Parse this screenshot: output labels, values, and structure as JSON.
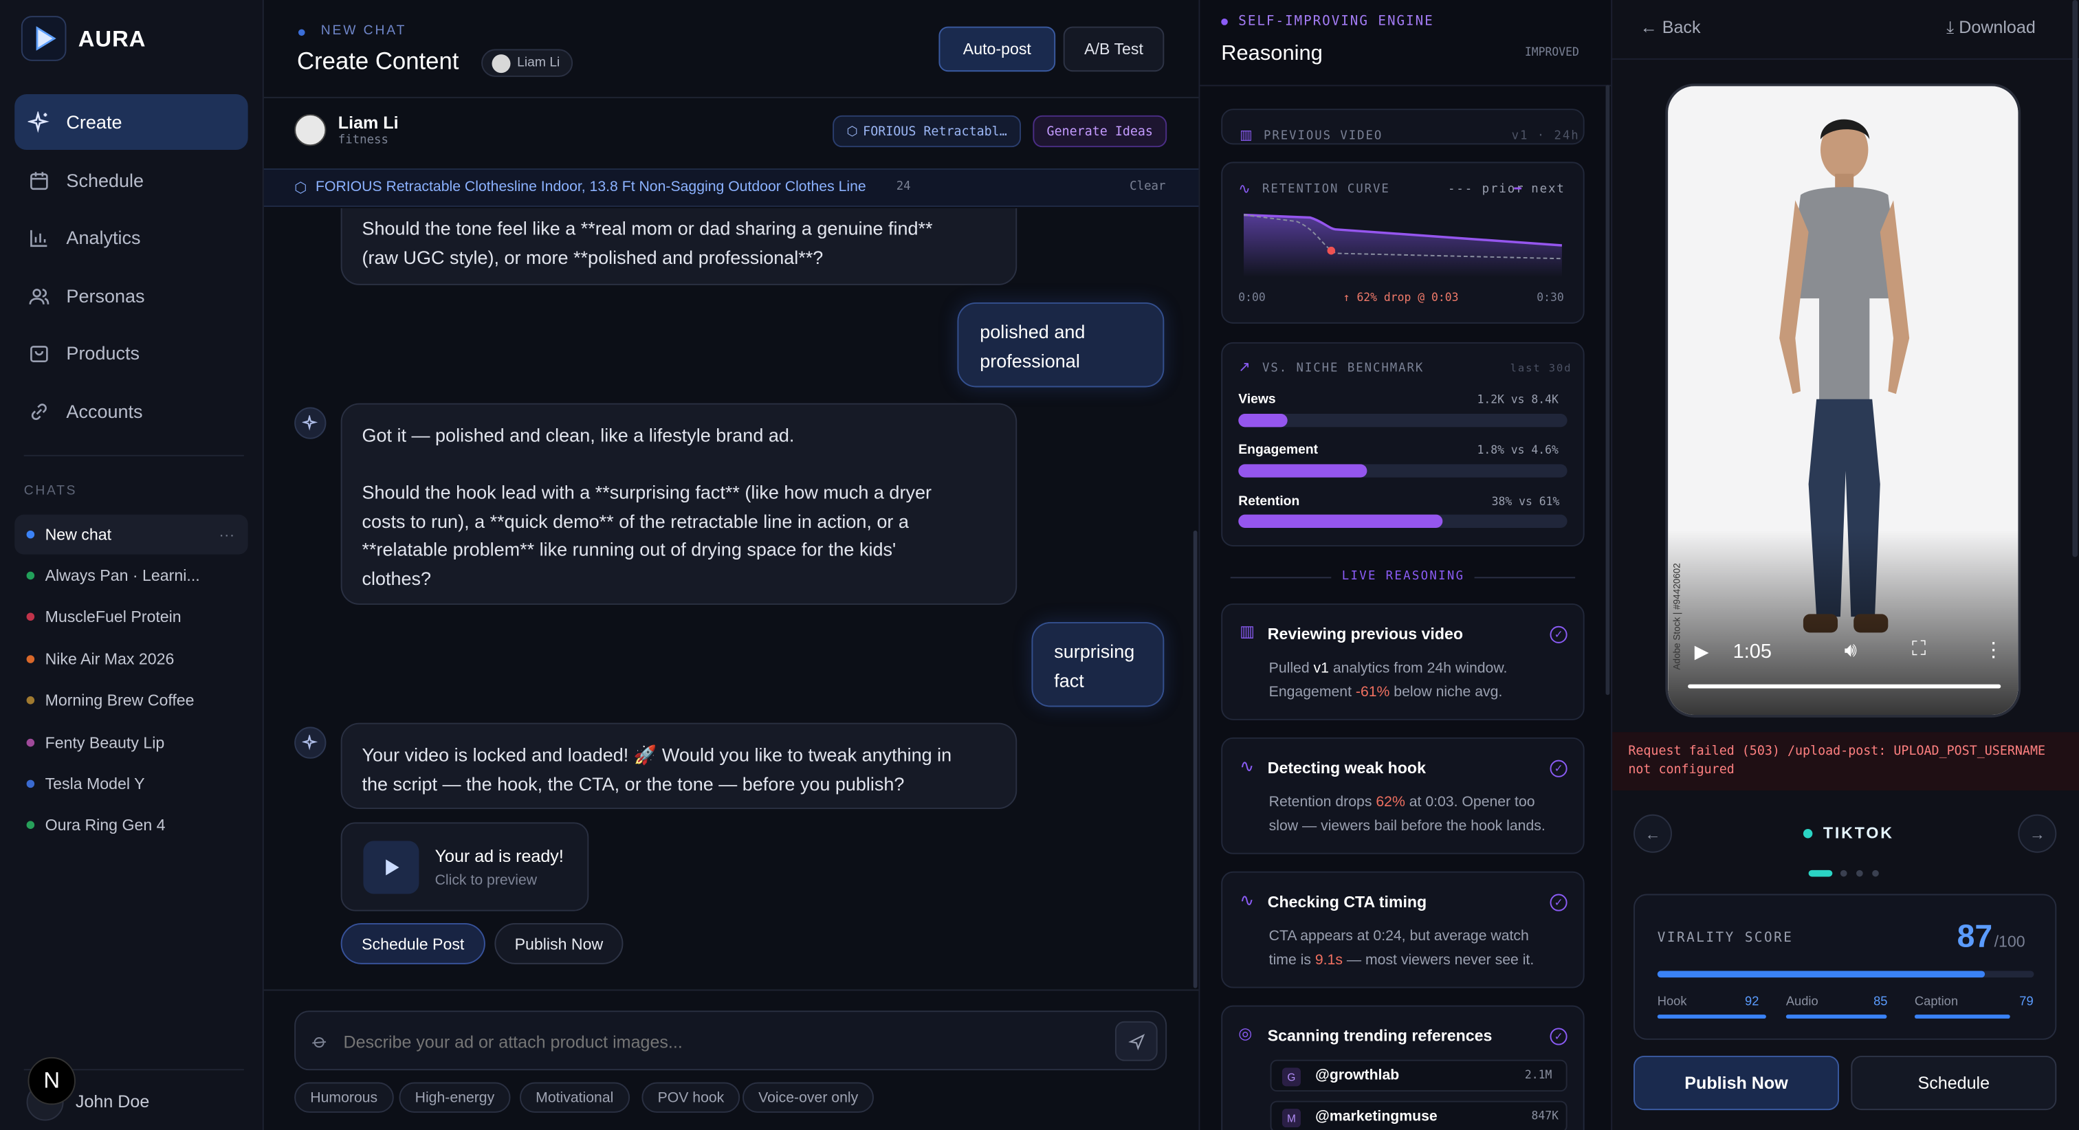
{
  "app": {
    "name": "AURA"
  },
  "sidebar": {
    "nav": [
      {
        "label": "Create",
        "icon": "sparkle-icon"
      },
      {
        "label": "Schedule",
        "icon": "calendar-icon"
      },
      {
        "label": "Analytics",
        "icon": "bar-chart-icon"
      },
      {
        "label": "Personas",
        "icon": "users-icon"
      },
      {
        "label": "Products",
        "icon": "bag-icon"
      },
      {
        "label": "Accounts",
        "icon": "link-icon"
      }
    ],
    "chats_heading": "CHATS",
    "chats": [
      {
        "label": "New chat",
        "color": "#3b82f6"
      },
      {
        "label": "Always Pan · Learni...",
        "color": "#22a05a"
      },
      {
        "label": "MuscleFuel Protein",
        "color": "#c0334a"
      },
      {
        "label": "Nike Air Max 2026",
        "color": "#d9682a"
      },
      {
        "label": "Morning Brew Coffee",
        "color": "#a07a30"
      },
      {
        "label": "Fenty Beauty Lip",
        "color": "#a04a9a"
      },
      {
        "label": "Tesla Model Y",
        "color": "#3a6ad0"
      },
      {
        "label": "Oura Ring Gen 4",
        "color": "#27a05a"
      }
    ],
    "more": "···",
    "user": {
      "name": "John Doe",
      "avatar_initial": "N"
    }
  },
  "header": {
    "kicker": "NEW CHAT",
    "title": "Create Content",
    "persona_pill": "Liam Li",
    "autopost": "Auto-post",
    "abtest": "A/B Test"
  },
  "persona": {
    "name": "Liam Li",
    "niche": "fitness",
    "product_pill": "FORIOUS Retractabl…",
    "ideas": "Generate Ideas"
  },
  "product_bar": {
    "name": "FORIOUS Retractable Clothesline Indoor, 13.8 Ft Non-Sagging Outdoor Clothes Line",
    "count": "24",
    "clear": "Clear"
  },
  "messages": {
    "m1": "Should the tone feel like a **real mom or dad sharing a genuine find**\n(raw UGC style), or more **polished and professional**?",
    "r1": "polished and\nprofessional",
    "m2": "Got it — polished and clean, like a lifestyle brand ad.\n\nShould the hook lead with a **surprising fact** (like how much a dryer\ncosts to run), a **quick demo** of the retractable line in action, or a\n**relatable problem** like running out of drying space for the kids'\nclothes?",
    "r2": "surprising\nfact",
    "m3": "Your video is locked and loaded! 🚀 Would you like to tweak anything in\nthe script — the hook, the CTA, or the tone — before you publish?",
    "ready_title": "Your ad is ready!",
    "ready_sub": "Click to preview",
    "schedule": "Schedule Post",
    "publish": "Publish Now"
  },
  "composer": {
    "placeholder": "Describe your ad or attach product images...",
    "chips": [
      "Humorous",
      "High-energy",
      "Motivational",
      "POV hook",
      "Voice-over only"
    ]
  },
  "engine": {
    "kicker": "SELF-IMPROVING ENGINE",
    "title": "Reasoning",
    "badge": "IMPROVED",
    "prev_video": "PREVIOUS VIDEO",
    "prev_meta": "v1 · 24h",
    "retention": {
      "label": "RETENTION CURVE",
      "legend_prior": "prior",
      "legend_next": "next",
      "t0": "0:00",
      "drop": "62% drop @ 0:03",
      "t1": "0:30"
    },
    "bench": {
      "label": "VS. NICHE BENCHMARK",
      "meta": "last 30d",
      "rows": [
        {
          "name": "Views",
          "value": "1.2K vs 8.4K",
          "fill": 0.15
        },
        {
          "name": "Engagement",
          "value": "1.8% vs 4.6%",
          "fill": 0.39
        },
        {
          "name": "Retention",
          "value": "38% vs 61%",
          "fill": 0.62
        }
      ]
    },
    "live": "LIVE REASONING",
    "steps": [
      {
        "title": "Reviewing previous video",
        "a": "Pulled ",
        "b": "v1",
        "c": " analytics from 24h window.",
        "d": "Engagement ",
        "e": "-61%",
        "f": " below niche avg.",
        "icon": "bar-chart-icon"
      },
      {
        "title": "Detecting weak hook",
        "a": "Retention drops ",
        "e": "62%",
        "f": " at 0:03. Opener too",
        "g": "slow — viewers bail before the hook lands.",
        "icon": "pulse-icon"
      },
      {
        "title": "Checking CTA timing",
        "a": "CTA appears at 0:24, but average watch",
        "d": "time is ",
        "e": "9.1s",
        "f": " — most viewers never see it.",
        "icon": "pulse-icon"
      },
      {
        "title": "Scanning trending references",
        "icon": "globe-icon"
      }
    ],
    "refs": [
      {
        "initial": "G",
        "handle": "@growthlab",
        "count": "2.1M"
      },
      {
        "initial": "M",
        "handle": "@marketingmuse",
        "count": "847K"
      }
    ]
  },
  "preview": {
    "back": "Back",
    "download": "Download",
    "time": "1:05",
    "watermark": "Adobe Stock | #94420602",
    "error": "Request failed (503) /upload-post: UPLOAD_POST_USERNAME\nnot configured",
    "platform": "TIKTOK",
    "score_label": "VIRALITY SCORE",
    "score": "87",
    "score_max": "/100",
    "score_value": 0.87,
    "sub": [
      {
        "name": "Hook",
        "value": "92"
      },
      {
        "name": "Audio",
        "value": "85"
      },
      {
        "name": "Caption",
        "value": "79"
      }
    ],
    "publish": "Publish Now",
    "schedule": "Schedule"
  }
}
